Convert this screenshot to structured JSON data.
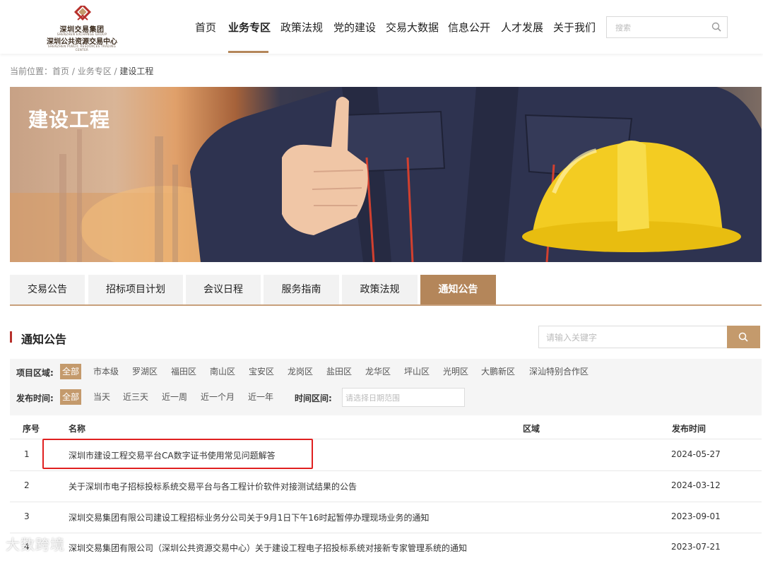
{
  "header": {
    "logo": {
      "line1": "深圳交易集团",
      "sub1": "SHENZHEN EXCHANGE GROUP",
      "line2": "深圳公共资源交易中心",
      "sub2": "SHENZHEN PUBLIC RESOURCES TRADING CENTER"
    },
    "nav": [
      {
        "label": "首页",
        "active": false
      },
      {
        "label": "业务专区",
        "active": true
      },
      {
        "label": "政策法规",
        "active": false
      },
      {
        "label": "党的建设",
        "active": false
      },
      {
        "label": "交易大数据",
        "active": false
      },
      {
        "label": "信息公开",
        "active": false
      },
      {
        "label": "人才发展",
        "active": false
      },
      {
        "label": "关于我们",
        "active": false
      }
    ],
    "search": {
      "placeholder": "搜索",
      "icon": "search-icon"
    }
  },
  "breadcrumb": {
    "prefix": "当前位置：",
    "items": [
      "首页",
      "业务专区"
    ],
    "separator": " / ",
    "current": "建设工程"
  },
  "banner": {
    "title": "建设工程"
  },
  "tabs": [
    {
      "label": "交易公告",
      "active": false
    },
    {
      "label": "招标项目计划",
      "active": false
    },
    {
      "label": "会议日程",
      "active": false
    },
    {
      "label": "服务指南",
      "active": false
    },
    {
      "label": "政策法规",
      "active": false
    },
    {
      "label": "通知公告",
      "active": true
    }
  ],
  "section": {
    "title": "通知公告",
    "keyword_placeholder": "请输入关键字"
  },
  "filters": {
    "region_label": "项目区域:",
    "regions": [
      "全部",
      "市本级",
      "罗湖区",
      "福田区",
      "南山区",
      "宝安区",
      "龙岗区",
      "盐田区",
      "龙华区",
      "坪山区",
      "光明区",
      "大鹏新区",
      "深汕特别合作区"
    ],
    "region_selected": "全部",
    "time_label": "发布时间:",
    "times": [
      "全部",
      "当天",
      "近三天",
      "近一周",
      "近一个月",
      "近一年"
    ],
    "time_selected": "全部",
    "range_label": "时间区间:",
    "range_placeholder": "请选择日期范围"
  },
  "table": {
    "headers": {
      "index": "序号",
      "name": "名称",
      "region": "区域",
      "date": "发布时间"
    },
    "rows": [
      {
        "index": "1",
        "name": "深圳市建设工程交易平台CA数字证书使用常见问题解答",
        "region": "",
        "date": "2024-05-27"
      },
      {
        "index": "2",
        "name": "关于深圳市电子招标投标系统交易平台与各工程计价软件对接测试结果的公告",
        "region": "",
        "date": "2024-03-12"
      },
      {
        "index": "3",
        "name": "深圳交易集团有限公司建设工程招标业务分公司关于9月1日下午16时起暂停办理现场业务的通知",
        "region": "",
        "date": "2023-09-01"
      },
      {
        "index": "4",
        "name": "深圳交易集团有限公司（深圳公共资源交易中心）关于建设工程电子招投标系统对接新专家管理系统的通知",
        "region": "",
        "date": "2023-07-21"
      }
    ]
  },
  "watermark": "大数跨境",
  "colors": {
    "accent": "#b4865a",
    "highlight": "#e02020",
    "section_bar": "#b7312c"
  }
}
